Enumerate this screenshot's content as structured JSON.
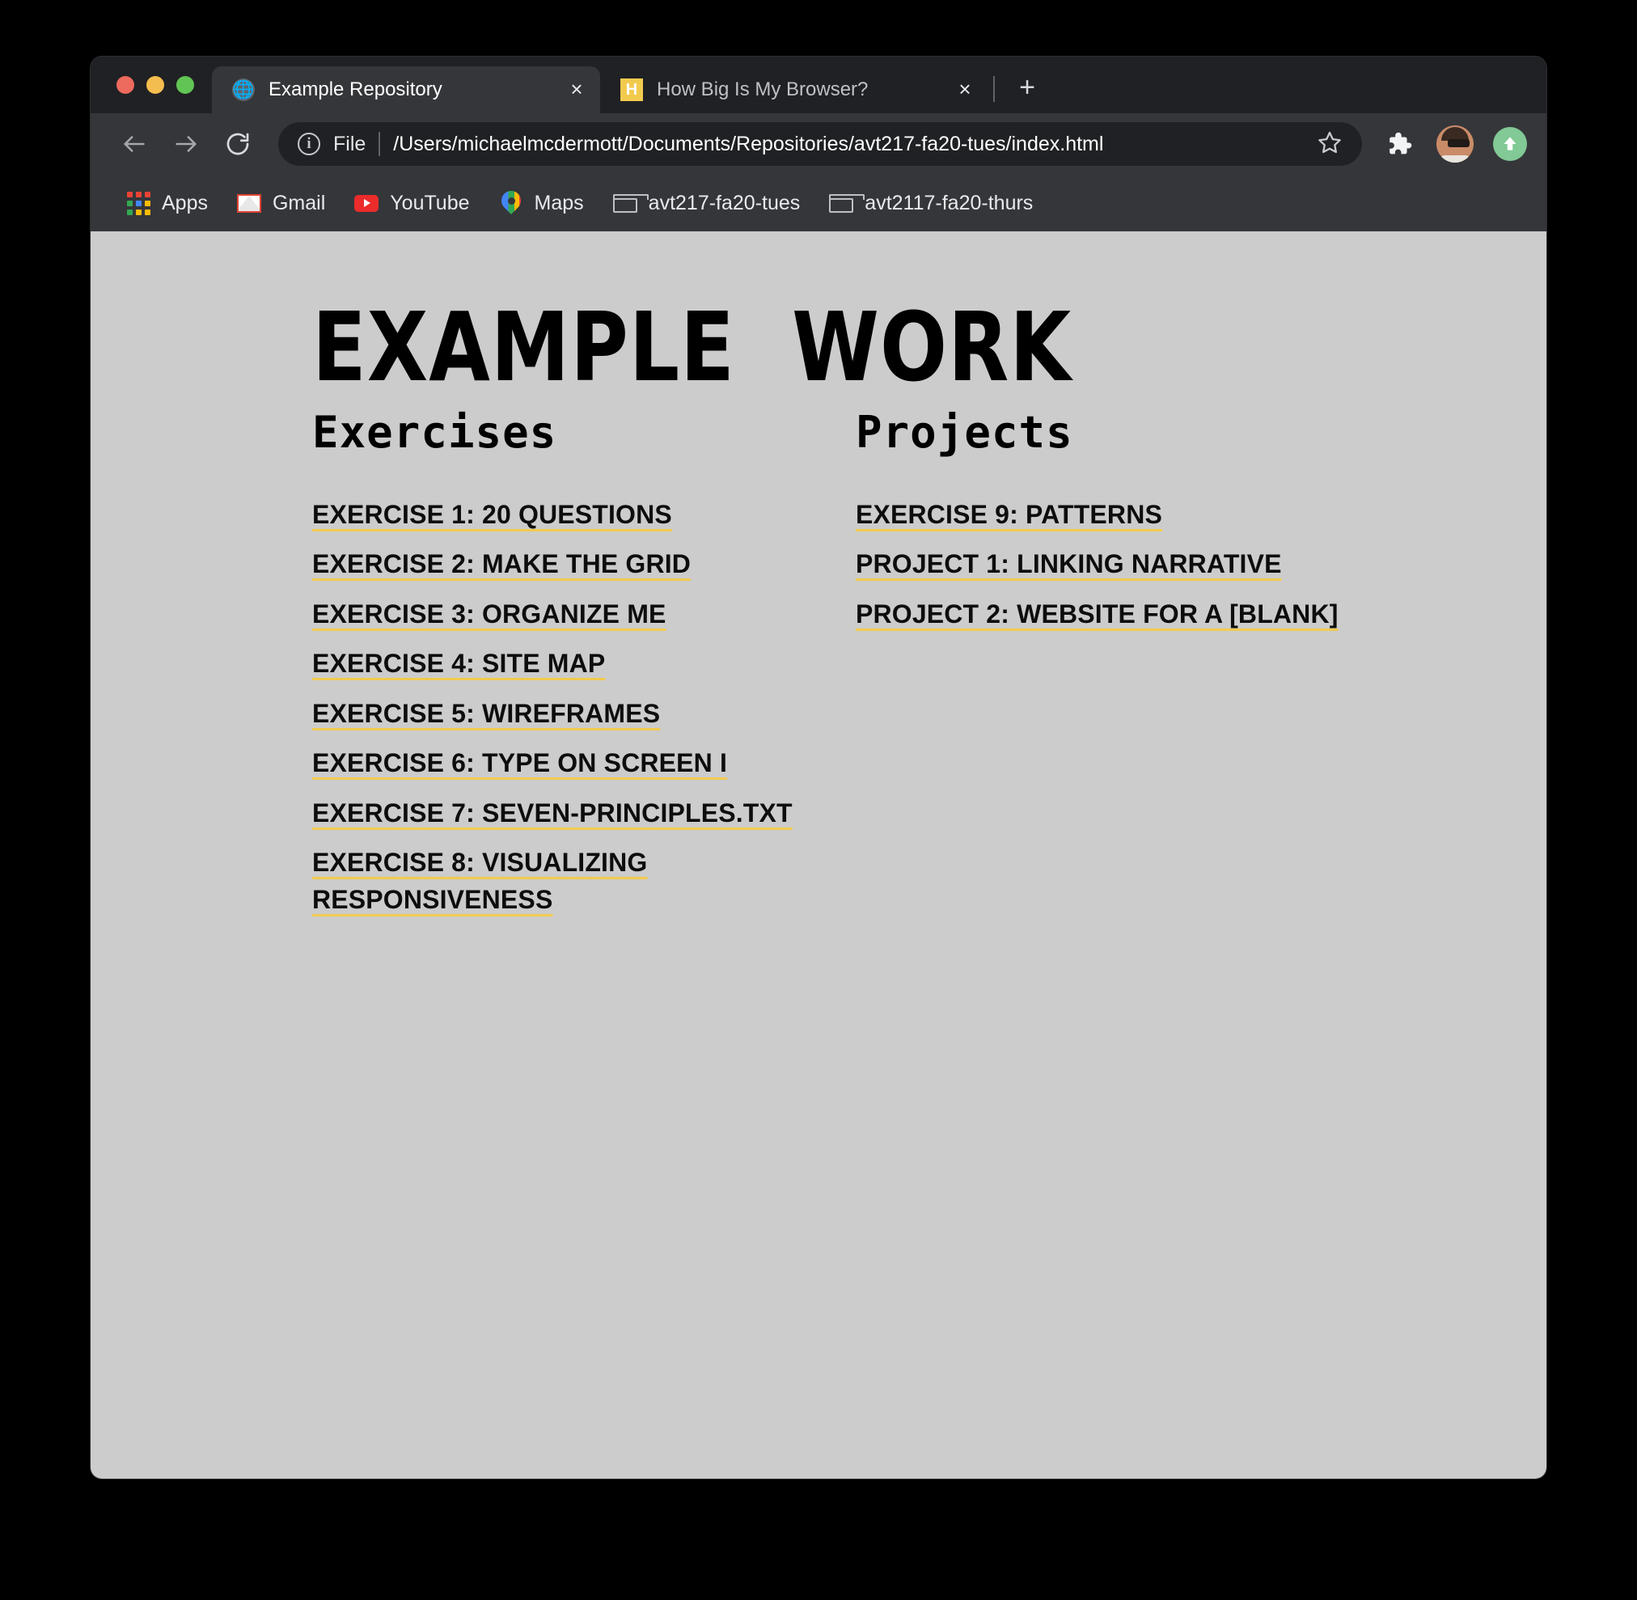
{
  "window": {
    "traffic_lights": [
      "close",
      "minimize",
      "maximize"
    ]
  },
  "tabs": [
    {
      "title": "Example Repository",
      "favicon": "globe-icon",
      "favicon_letter": "",
      "active": true,
      "close_label": "×"
    },
    {
      "title": "How Big Is My Browser?",
      "favicon": "letter-favicon",
      "favicon_letter": "H",
      "active": false,
      "close_label": "×"
    }
  ],
  "new_tab_label": "+",
  "toolbar": {
    "back_label": "Back",
    "forward_label": "Forward",
    "reload_label": "Reload",
    "info_label": "ⓘ",
    "scheme_label": "File",
    "url": "/Users/michaelmcdermott/Documents/Repositories/avt217-fa20-tues/index.html",
    "bookmark_label": "Bookmark this page",
    "extensions_label": "Extensions",
    "profile_label": "Profile",
    "update_label": "Update"
  },
  "bookmarks": [
    {
      "label": "Apps",
      "icon": "apps-grid-icon"
    },
    {
      "label": "Gmail",
      "icon": "gmail-icon"
    },
    {
      "label": "YouTube",
      "icon": "youtube-icon"
    },
    {
      "label": "Maps",
      "icon": "maps-pin-icon"
    },
    {
      "label": "avt217-fa20-tues",
      "icon": "folder-icon"
    },
    {
      "label": "avt2117-fa20-thurs",
      "icon": "folder-icon"
    }
  ],
  "page": {
    "title": "EXAMPLE  WORK",
    "background_color": "#cccccc",
    "link_underline_color": "#f2cb4e",
    "columns": [
      {
        "heading": "Exercises",
        "links": [
          "EXERCISE 1: 20 QUESTIONS",
          "EXERCISE 2: MAKE THE GRID",
          "EXERCISE 3: ORGANIZE ME",
          "EXERCISE 4: SITE MAP",
          "EXERCISE 5: WIREFRAMES",
          "EXERCISE 6: TYPE ON SCREEN I",
          "EXERCISE 7: SEVEN-PRINCIPLES.TXT",
          "EXERCISE 8: VISUALIZING RESPONSIVENESS"
        ]
      },
      {
        "heading": "Projects",
        "links": [
          "EXERCISE 9: PATTERNS",
          "PROJECT 1: LINKING NARRATIVE",
          "PROJECT 2: WEBSITE FOR A [BLANK]"
        ]
      }
    ]
  }
}
